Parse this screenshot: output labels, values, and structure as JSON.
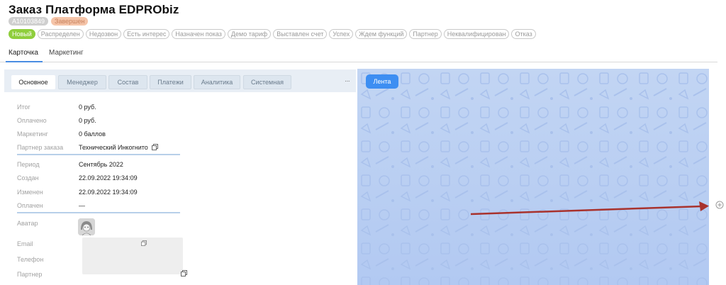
{
  "header": {
    "title": "Заказ Платформа EDPRObiz",
    "order_id": "A10103849",
    "completion_badge": "Завершен"
  },
  "status_pipeline": [
    {
      "label": "Новый",
      "active": true
    },
    {
      "label": "Распределен",
      "active": false
    },
    {
      "label": "Недозвон",
      "active": false
    },
    {
      "label": "Есть интерес",
      "active": false
    },
    {
      "label": "Назначен показ",
      "active": false
    },
    {
      "label": "Демо тариф",
      "active": false
    },
    {
      "label": "Выставлен счет",
      "active": false
    },
    {
      "label": "Успех",
      "active": false
    },
    {
      "label": "Ждем функций",
      "active": false
    },
    {
      "label": "Партнер",
      "active": false
    },
    {
      "label": "Неквалифицирован",
      "active": false
    },
    {
      "label": "Отказ",
      "active": false
    }
  ],
  "main_tabs": [
    {
      "label": "Карточка",
      "active": true
    },
    {
      "label": "Маркетинг",
      "active": false
    }
  ],
  "sub_tabs": [
    {
      "label": "Основное",
      "active": true
    },
    {
      "label": "Менеджер",
      "active": false
    },
    {
      "label": "Состав",
      "active": false
    },
    {
      "label": "Платежи",
      "active": false
    },
    {
      "label": "Аналитика",
      "active": false
    },
    {
      "label": "Системная",
      "active": false
    }
  ],
  "more_menu_label": "···",
  "fields": {
    "total": {
      "label": "Итог",
      "value": "0 руб."
    },
    "paid_amount": {
      "label": "Оплачено",
      "value": "0 руб."
    },
    "marketing": {
      "label": "Маркетинг",
      "value": "0 баллов"
    },
    "order_partner": {
      "label": "Партнер заказа",
      "value": "Технический Инкогнито"
    },
    "period": {
      "label": "Период",
      "value": "Сентябрь 2022"
    },
    "created": {
      "label": "Создан",
      "value": "22.09.2022 19:34:09"
    },
    "modified": {
      "label": "Изменен",
      "value": "22.09.2022 19:34:09"
    },
    "paid_at": {
      "label": "Оплачен",
      "value": "—"
    },
    "avatar": {
      "label": "Аватар"
    },
    "email": {
      "label": "Email"
    },
    "phone": {
      "label": "Телефон"
    },
    "partner": {
      "label": "Партнер"
    }
  },
  "feed": {
    "button_label": "Лента"
  },
  "colors": {
    "status_active": "#8fce3d",
    "accent_blue": "#3d8ef2",
    "tab_underline": "#4a8de2",
    "feed_background": "#b9cff3",
    "arrow": "#a8322d",
    "completion_badge": "#f5c4a8"
  },
  "icons": {
    "copy": "copy-icon",
    "add": "plus-circle-icon",
    "more": "dots-icon"
  }
}
